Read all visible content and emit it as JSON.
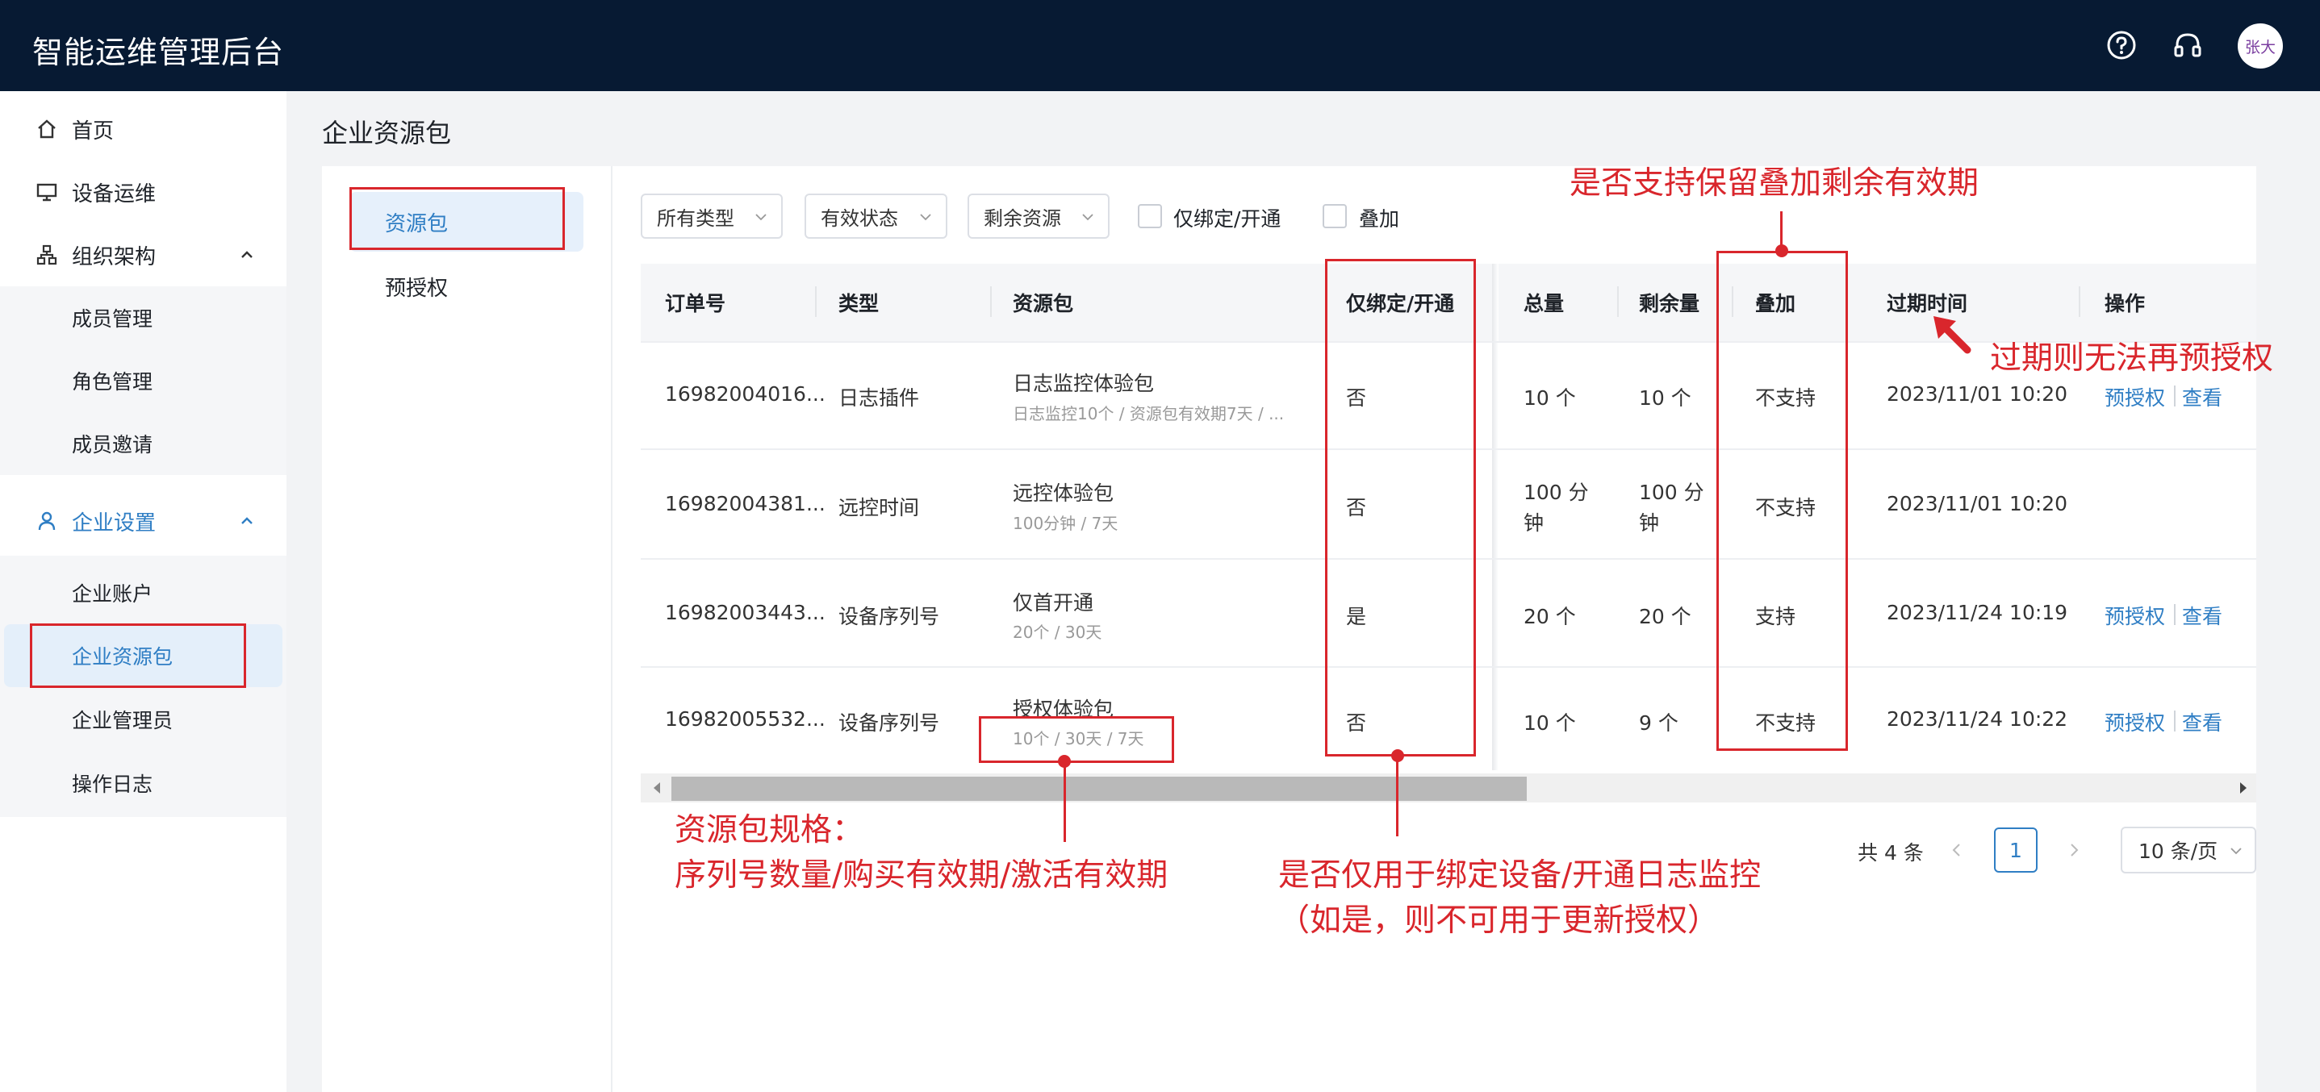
{
  "app": {
    "title": "智能运维管理后台",
    "avatar_text": "张大"
  },
  "topbar": {
    "icons": [
      "help-circle-icon",
      "headset-icon"
    ]
  },
  "sidebar": {
    "items": [
      {
        "label": "首页",
        "icon": "home-icon"
      },
      {
        "label": "设备运维",
        "icon": "monitor-icon"
      },
      {
        "label": "组织架构",
        "icon": "org-chart-icon",
        "expanded": true
      },
      {
        "label": "企业设置",
        "icon": "user-icon",
        "expanded": true,
        "active": true
      }
    ],
    "org_children": [
      "成员管理",
      "角色管理",
      "成员邀请"
    ],
    "enterprise_children": [
      "企业账户",
      "企业资源包",
      "企业管理员",
      "操作日志"
    ]
  },
  "page": {
    "title": "企业资源包"
  },
  "subtabs": [
    "资源包",
    "预授权"
  ],
  "filters": {
    "type": "所有类型",
    "status": "有效状态",
    "remaining": "剩余资源",
    "check_bind_only": "仅绑定/开通",
    "check_stack": "叠加"
  },
  "table": {
    "headers": [
      "订单号",
      "类型",
      "资源包",
      "仅绑定/开通",
      "总量",
      "剩余量",
      "叠加",
      "过期时间",
      "操作"
    ],
    "rows": [
      {
        "order": "16982004016...",
        "type": "日志插件",
        "pkg_name": "日志监控体验包",
        "pkg_spec": "日志监控10个 / 资源包有效期7天 / ...",
        "bind_only": "否",
        "total": "10 个",
        "remain": "10 个",
        "stack": "不支持",
        "expire": "2023/11/01 10:20",
        "actions": [
          "预授权",
          "查看"
        ]
      },
      {
        "order": "16982004381...",
        "type": "远控时间",
        "pkg_name": "远控体验包",
        "pkg_spec": "100分钟 / 7天",
        "bind_only": "否",
        "total_l1": "100 分",
        "total_l2": "钟",
        "remain_l1": "100 分",
        "remain_l2": "钟",
        "stack": "不支持",
        "expire": "2023/11/01 10:20",
        "actions": []
      },
      {
        "order": "16982003443...",
        "type": "设备序列号",
        "pkg_name": "仅首开通",
        "pkg_spec": "20个 / 30天",
        "bind_only": "是",
        "total": "20 个",
        "remain": "20 个",
        "stack": "支持",
        "expire": "2023/11/24 10:19",
        "actions": [
          "预授权",
          "查看"
        ]
      },
      {
        "order": "16982005532...",
        "type": "设备序列号",
        "pkg_name": "授权体验包",
        "pkg_spec": "10个 / 30天 / 7天",
        "bind_only": "否",
        "total": "10 个",
        "remain": "9 个",
        "stack": "不支持",
        "expire": "2023/11/24 10:22",
        "actions": [
          "预授权",
          "查看"
        ]
      }
    ]
  },
  "pagination": {
    "total": "共 4 条",
    "current": "1",
    "page_size": "10 条/页"
  },
  "annotations": {
    "stack_note": "是否支持保留叠加剩余有效期",
    "expire_note": "过期则无法再预授权",
    "spec_note_l1": "资源包规格：",
    "spec_note_l2": "序列号数量/购买有效期/激活有效期",
    "bind_note_l1": "是否仅用于绑定设备/开通日志监控",
    "bind_note_l2": "（如是，则不可用于更新授权）",
    "color": "#d9262c"
  }
}
